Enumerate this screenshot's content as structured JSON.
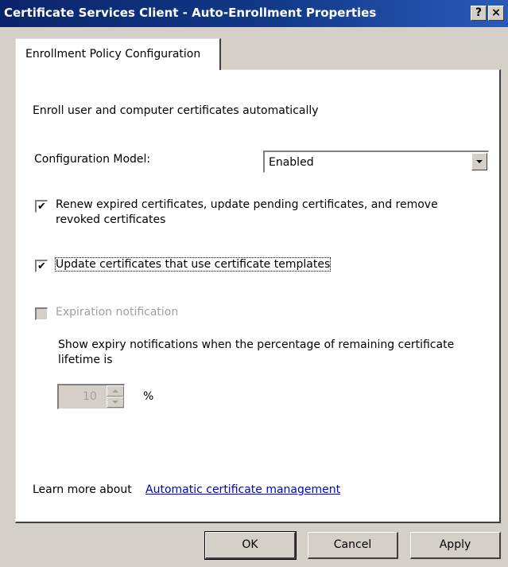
{
  "window": {
    "title": "Certificate Services Client - Auto-Enrollment Properties",
    "help_glyph": "?",
    "close_glyph": "×"
  },
  "tabs": [
    {
      "label": "Enrollment Policy Configuration",
      "selected": true
    }
  ],
  "panel": {
    "intro": "Enroll user and computer certificates automatically",
    "config_model": {
      "label": "Configuration Model:",
      "value": "Enabled",
      "icon": "dropdown-arrow-icon"
    },
    "renew_checkbox": {
      "checked": true,
      "check_glyph": "✔",
      "label_line1": "Renew expired certificates, update pending certificates, and remove",
      "label_line2": "revoked certificates"
    },
    "update_checkbox": {
      "checked": true,
      "check_glyph": "✔",
      "label": "Update certificates that use certificate templates"
    },
    "expiration_checkbox": {
      "checked": false,
      "enabled": false,
      "label": "Expiration notification"
    },
    "expiry_text_line1": "Show expiry notifications when the percentage of remaining certificate",
    "expiry_text_line2": "lifetime is",
    "percentage": {
      "value": "10",
      "unit": "%"
    },
    "learn_more": {
      "prefix": "Learn more about",
      "link": "Automatic certificate management"
    }
  },
  "buttons": {
    "ok": "OK",
    "cancel": "Cancel",
    "apply": "Apply"
  }
}
